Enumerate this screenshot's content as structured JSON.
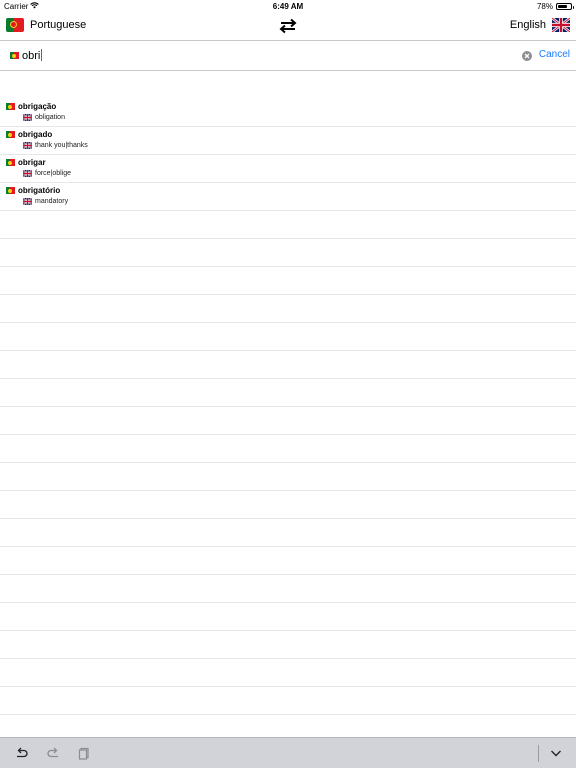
{
  "status_bar": {
    "carrier": "Carrier",
    "time": "6:49 AM",
    "battery_percent": "78%",
    "battery_level": 0.78,
    "wifi_icon": "wifi-icon"
  },
  "language_bar": {
    "source_language": "Portuguese",
    "target_language": "English",
    "source_flag": "portugal-flag-icon",
    "target_flag": "uk-flag-icon",
    "swap_icon": "swap-arrows-icon"
  },
  "search": {
    "value": "obri",
    "cancel_label": "Cancel",
    "clear_icon": "clear-icon",
    "accent_color": "#1a7bff"
  },
  "results": [
    {
      "term": "obrigação",
      "translation": "obligation"
    },
    {
      "term": "obrigado",
      "translation": "thank you|thanks"
    },
    {
      "term": "obrigar",
      "translation": "force|oblige"
    },
    {
      "term": "obrigatório",
      "translation": "mandatory"
    }
  ],
  "toolbar": {
    "undo_icon": "undo-icon",
    "redo_icon": "redo-icon",
    "paste_icon": "clipboard-icon",
    "dismiss_icon": "chevron-down-icon"
  }
}
